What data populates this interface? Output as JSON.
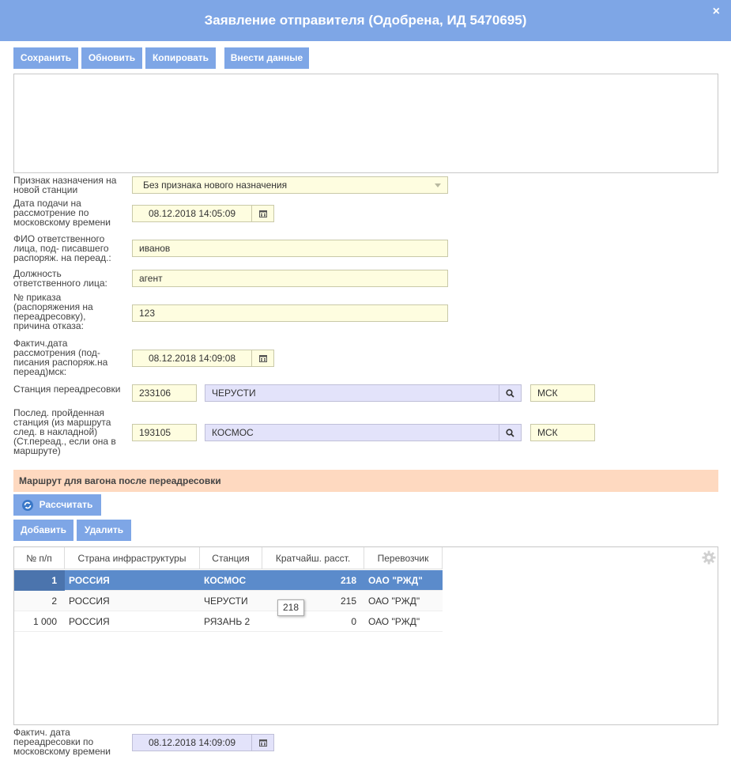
{
  "dialog": {
    "title": "Заявление отправителя (Одобрена, ИД 5470695)",
    "close_icon": "×"
  },
  "toolbar": {
    "save": "Сохранить",
    "refresh": "Обновить",
    "copy": "Копировать",
    "enter_data": "Внести данные"
  },
  "form": {
    "new_station_sign_label": "Признак назначения на новой станции",
    "new_station_sign_value": "Без признака нового назначения",
    "submit_date_label": "Дата подачи на рассмотрение по московскому времени",
    "submit_date_value": "08.12.2018 14:05:09",
    "responsible_name_label": "ФИО ответственного лица, под- писавшего распоряж. на переад.:",
    "responsible_name_value": "иванов",
    "responsible_position_label": "Должность ответственного лица:",
    "responsible_position_value": "агент",
    "order_no_label": "№ приказа (распоряжения на переадресовку), причина отказа:",
    "order_no_value": "123",
    "actual_review_date_label": "Фактич.дата рассмотрения (под- писания распоряж.на переад)мск:",
    "actual_review_date_value": "08.12.2018 14:09:08",
    "redirect_station_label": "Станция переадресовки",
    "redirect_station_code": "233106",
    "redirect_station_name": "ЧЕРУСТИ",
    "redirect_station_road": "МСК",
    "last_station_label": "Послед. пройденная станция (из маршрута след. в накладной) (Ст.переад., если она в маршруте)",
    "last_station_code": "193105",
    "last_station_name": "КОСМОС",
    "last_station_road": "МСК",
    "actual_redirect_date_label": "Фактич. дата переадресовки по московскому времени",
    "actual_redirect_date_value": "08.12.2018 14:09:09"
  },
  "route": {
    "section_title": "Маршрут для вагона после переадресовки",
    "calculate": "Рассчитать",
    "add": "Добавить",
    "delete": "Удалить",
    "columns": [
      "№ п/п",
      "Страна инфраструктуры",
      "Станция",
      "Кратчайш. расст.",
      "Перевозчик"
    ],
    "rows": [
      {
        "n": "1",
        "country": "РОССИЯ",
        "station": "КОСМОС",
        "dist": "218",
        "carrier": "ОАО \"РЖД\"",
        "selected": true
      },
      {
        "n": "2",
        "country": "РОССИЯ",
        "station": "ЧЕРУСТИ",
        "dist": "215",
        "carrier": "ОАО \"РЖД\"",
        "selected": false
      },
      {
        "n": "1 000",
        "country": "РОССИЯ",
        "station": "РЯЗАНЬ 2",
        "dist": "0",
        "carrier": "ОАО \"РЖД\"",
        "selected": false
      }
    ],
    "tooltip": "218"
  },
  "icons": {
    "calendar": "calendar-icon",
    "search": "search-icon",
    "refresh": "refresh-icon",
    "settings": "gear-icon"
  },
  "colors": {
    "accent": "#7ea6e6",
    "input_yellow": "#fefde0",
    "input_blue": "#e3e3fa",
    "section_bg": "#fed9c0",
    "selected_row": "#5b8bcb"
  }
}
